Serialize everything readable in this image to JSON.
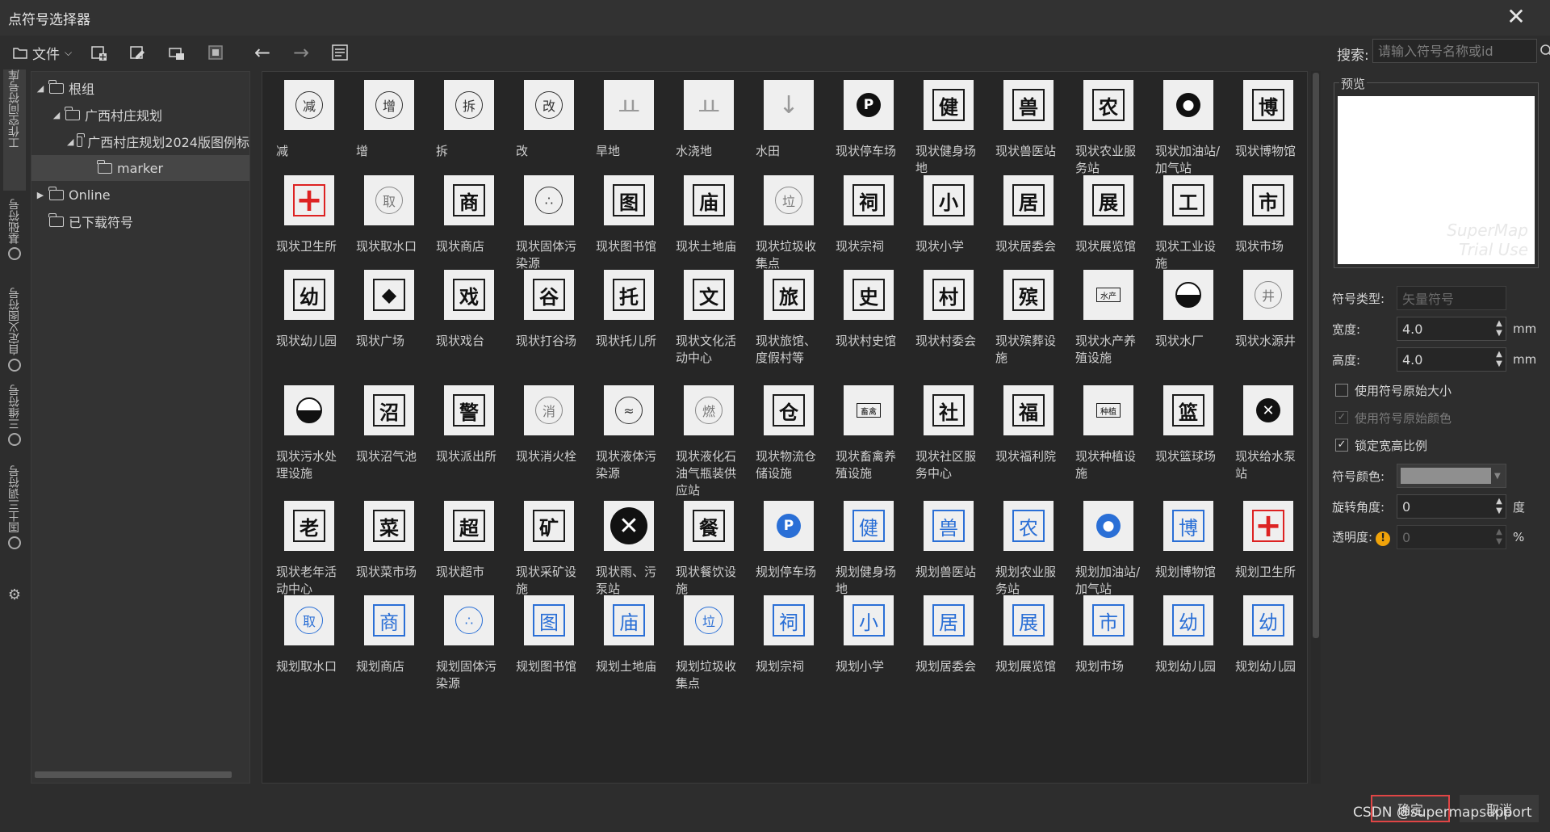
{
  "window": {
    "title": "点符号选择器"
  },
  "toolbar": {
    "file_label": "文件",
    "search_label": "搜索:",
    "search_placeholder": "请输入符号名称或id"
  },
  "side_tabs": [
    "工作空间符号库",
    "基础符号",
    "自定义图符号",
    "三维符号",
    "国土三调符号"
  ],
  "tree": [
    {
      "label": "根组",
      "level": 0,
      "expanded": true,
      "arrow": "◢"
    },
    {
      "label": "广西村庄规划",
      "level": 1,
      "expanded": true,
      "arrow": "◢"
    },
    {
      "label": "广西村庄规划2024版图例标",
      "level": 2,
      "expanded": true,
      "arrow": "◢"
    },
    {
      "label": "marker",
      "level": 3,
      "selected": true,
      "arrow": ""
    },
    {
      "label": "Online",
      "level": 0,
      "expanded": false,
      "arrow": "▶"
    },
    {
      "label": "已下载符号",
      "level": 0,
      "arrow": ""
    }
  ],
  "symbols": [
    [
      {
        "label": "减",
        "glyph": "减",
        "style": "circle"
      },
      {
        "label": "增",
        "glyph": "增",
        "style": "circle"
      },
      {
        "label": "拆",
        "glyph": "拆",
        "style": "circle"
      },
      {
        "label": "改",
        "glyph": "改",
        "style": "circle"
      },
      {
        "label": "旱地",
        "glyph": "ㅛ",
        "style": "plain-gray"
      },
      {
        "label": "水浇地",
        "glyph": "ㅛ",
        "style": "plain-gray"
      },
      {
        "label": "水田",
        "glyph": "↓",
        "style": "plain-gray"
      },
      {
        "label": "现状停车场",
        "glyph": "P",
        "style": "filled-circle"
      },
      {
        "label": "现状健身场地",
        "glyph": "健",
        "style": "box"
      },
      {
        "label": "现状兽医站",
        "glyph": "兽",
        "style": "box"
      },
      {
        "label": "现状农业服务站",
        "glyph": "农",
        "style": "box"
      },
      {
        "label": "现状加油站/加气站",
        "glyph": "●",
        "style": "filled-circle"
      },
      {
        "label": "现状博物馆",
        "glyph": "博",
        "style": "box"
      }
    ],
    [
      {
        "label": "现状卫生所",
        "glyph": "+",
        "style": "red-cross"
      },
      {
        "label": "现状取水口",
        "glyph": "取",
        "style": "circle-gray"
      },
      {
        "label": "现状商店",
        "glyph": "商",
        "style": "box"
      },
      {
        "label": "现状固体污染源",
        "glyph": "∴",
        "style": "circle"
      },
      {
        "label": "现状图书馆",
        "glyph": "图",
        "style": "box"
      },
      {
        "label": "现状土地庙",
        "glyph": "庙",
        "style": "box"
      },
      {
        "label": "现状垃圾收集点",
        "glyph": "垃",
        "style": "circle-gray"
      },
      {
        "label": "现状宗祠",
        "glyph": "祠",
        "style": "box"
      },
      {
        "label": "现状小学",
        "glyph": "小",
        "style": "box"
      },
      {
        "label": "现状居委会",
        "glyph": "居",
        "style": "box"
      },
      {
        "label": "现状展览馆",
        "glyph": "展",
        "style": "box"
      },
      {
        "label": "现状工业设施",
        "glyph": "工",
        "style": "box"
      },
      {
        "label": "现状市场",
        "glyph": "市",
        "style": "box"
      }
    ],
    [
      {
        "label": "现状幼儿园",
        "glyph": "幼",
        "style": "box"
      },
      {
        "label": "现状广场",
        "glyph": "◆",
        "style": "box"
      },
      {
        "label": "现状戏台",
        "glyph": "戏",
        "style": "box"
      },
      {
        "label": "现状打谷场",
        "glyph": "谷",
        "style": "box"
      },
      {
        "label": "现状托儿所",
        "glyph": "托",
        "style": "box"
      },
      {
        "label": "现状文化活动中心",
        "glyph": "文",
        "style": "box"
      },
      {
        "label": "现状旅馆、度假村等",
        "glyph": "旅",
        "style": "box"
      },
      {
        "label": "现状村史馆",
        "glyph": "史",
        "style": "box"
      },
      {
        "label": "现状村委会",
        "glyph": "村",
        "style": "box"
      },
      {
        "label": "现状殡葬设施",
        "glyph": "殡",
        "style": "box"
      },
      {
        "label": "现状水产养殖设施",
        "glyph": "水产",
        "style": "small-box"
      },
      {
        "label": "现状水厂",
        "glyph": "◓",
        "style": "half-circle"
      },
      {
        "label": "现状水源井",
        "glyph": "井",
        "style": "circle-gray"
      }
    ],
    [
      {
        "label": "现状污水处理设施",
        "glyph": "◓",
        "style": "half-circle"
      },
      {
        "label": "现状沼气池",
        "glyph": "沼",
        "style": "box"
      },
      {
        "label": "现状派出所",
        "glyph": "警",
        "style": "box"
      },
      {
        "label": "现状消火栓",
        "glyph": "消",
        "style": "circle-gray"
      },
      {
        "label": "现状液体污染源",
        "glyph": "≈",
        "style": "circle"
      },
      {
        "label": "现状液化石油气瓶装供应站",
        "glyph": "燃",
        "style": "circle-gray"
      },
      {
        "label": "现状物流仓储设施",
        "glyph": "仓",
        "style": "box"
      },
      {
        "label": "现状畜禽养殖设施",
        "glyph": "畜禽",
        "style": "small-box"
      },
      {
        "label": "现状社区服务中心",
        "glyph": "社",
        "style": "box"
      },
      {
        "label": "现状福利院",
        "glyph": "福",
        "style": "box"
      },
      {
        "label": "现状种植设施",
        "glyph": "种植",
        "style": "small-box"
      },
      {
        "label": "现状篮球场",
        "glyph": "篮",
        "style": "box"
      },
      {
        "label": "现状给水泵站",
        "glyph": "✕",
        "style": "x-circle"
      }
    ],
    [
      {
        "label": "现状老年活动中心",
        "glyph": "老",
        "style": "box"
      },
      {
        "label": "现状菜市场",
        "glyph": "菜",
        "style": "box"
      },
      {
        "label": "现状超市",
        "glyph": "超",
        "style": "box"
      },
      {
        "label": "现状采矿设施",
        "glyph": "矿",
        "style": "box"
      },
      {
        "label": "现状雨、污泵站",
        "glyph": "✕",
        "style": "x-circle-big"
      },
      {
        "label": "现状餐饮设施",
        "glyph": "餐",
        "style": "box"
      },
      {
        "label": "规划停车场",
        "glyph": "P",
        "style": "blue-filled-circle"
      },
      {
        "label": "规划健身场地",
        "glyph": "健",
        "style": "blue-box"
      },
      {
        "label": "规划兽医站",
        "glyph": "兽",
        "style": "blue-box"
      },
      {
        "label": "规划农业服务站",
        "glyph": "农",
        "style": "blue-box"
      },
      {
        "label": "规划加油站/加气站",
        "glyph": "●",
        "style": "blue-filled-circle"
      },
      {
        "label": "规划博物馆",
        "glyph": "博",
        "style": "blue-box"
      },
      {
        "label": "规划卫生所",
        "glyph": "+",
        "style": "red-cross"
      }
    ],
    [
      {
        "label": "规划取水口",
        "glyph": "取",
        "style": "blue-circle"
      },
      {
        "label": "规划商店",
        "glyph": "商",
        "style": "blue-box"
      },
      {
        "label": "规划固体污染源",
        "glyph": "∴",
        "style": "blue-circle"
      },
      {
        "label": "规划图书馆",
        "glyph": "图",
        "style": "blue-box"
      },
      {
        "label": "规划土地庙",
        "glyph": "庙",
        "style": "blue-box"
      },
      {
        "label": "规划垃圾收集点",
        "glyph": "垃",
        "style": "blue-circle"
      },
      {
        "label": "规划宗祠",
        "glyph": "祠",
        "style": "blue-box"
      },
      {
        "label": "规划小学",
        "glyph": "小",
        "style": "blue-box"
      },
      {
        "label": "规划居委会",
        "glyph": "居",
        "style": "blue-box"
      },
      {
        "label": "规划展览馆",
        "glyph": "展",
        "style": "blue-box"
      },
      {
        "label": "规划市场",
        "glyph": "市",
        "style": "blue-box"
      },
      {
        "label": "规划幼儿园",
        "glyph": "幼",
        "style": "blue-box"
      },
      {
        "label": "规划幼儿园",
        "glyph": "幼",
        "style": "blue-box"
      }
    ]
  ],
  "preview": {
    "legend": "预览",
    "watermark_line1": "SuperMap",
    "watermark_line2": "Trial Use"
  },
  "properties": {
    "type_label": "符号类型:",
    "type_value": "矢量符号",
    "width_label": "宽度:",
    "width_value": "4.0",
    "width_unit": "mm",
    "height_label": "高度:",
    "height_value": "4.0",
    "height_unit": "mm",
    "use_original_size_label": "使用符号原始大小",
    "use_original_size": false,
    "use_original_color_label": "使用符号原始颜色",
    "use_original_color": true,
    "lock_ratio_label": "锁定宽高比例",
    "lock_ratio": true,
    "color_label": "符号颜色:",
    "color_value": "#8f8f8f",
    "rotation_label": "旋转角度:",
    "rotation_value": "0",
    "rotation_unit": "度",
    "opacity_label": "透明度:",
    "opacity_value": "0",
    "opacity_unit": "%"
  },
  "buttons": {
    "ok": "确定",
    "cancel": "取消"
  },
  "watermark": "CSDN @supermapsupport",
  "colors": {
    "accent_blue": "#2a6fd6",
    "ok_border": "#e04545",
    "warn": "#f0a30a"
  }
}
